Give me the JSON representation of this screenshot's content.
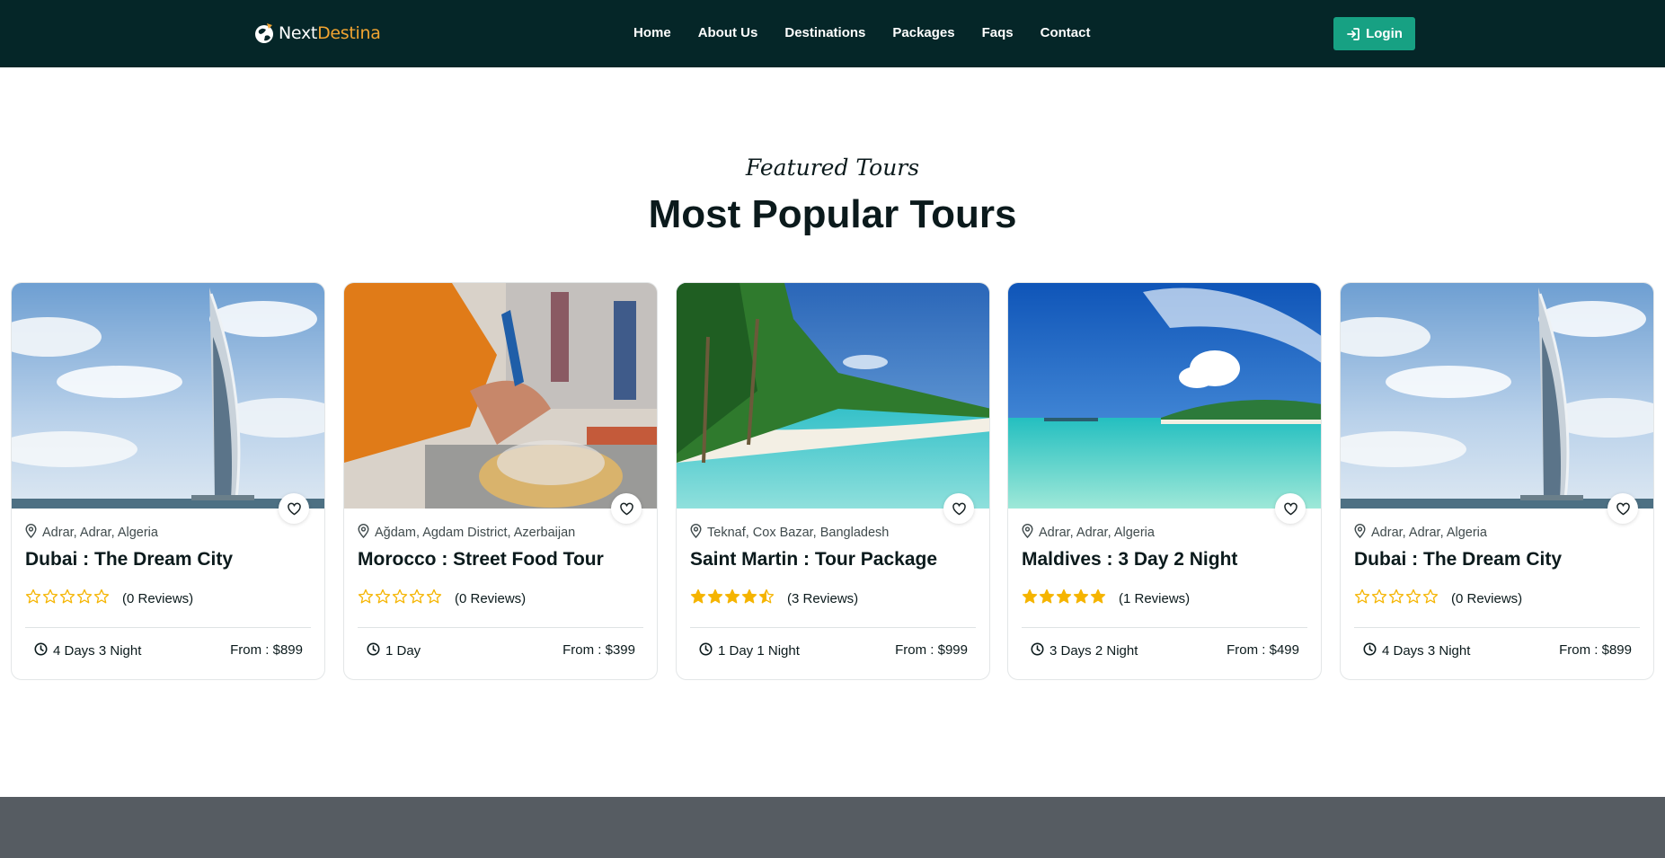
{
  "nav": {
    "logo": {
      "part1": "Next",
      "part2": "Destina"
    },
    "links": [
      "Home",
      "About Us",
      "Destinations",
      "Packages",
      "Faqs",
      "Contact"
    ],
    "login_label": "Login"
  },
  "section": {
    "eyebrow": "Featured Tours",
    "title": "Most Popular Tours"
  },
  "tours": [
    {
      "location": "Adrar, Adrar, Algeria",
      "title": "Dubai : The Dream City",
      "rating": 0,
      "reviews": "(0 Reviews)",
      "duration": "4 Days 3 Night",
      "price": "From : $899",
      "image": "dubai"
    },
    {
      "location": "Ağdam, Agdam District, Azerbaijan",
      "title": "Morocco : Street Food Tour",
      "rating": 0,
      "reviews": "(0 Reviews)",
      "duration": "1 Day",
      "price": "From : $399",
      "image": "street-food"
    },
    {
      "location": "Teknaf, Cox Bazar, Bangladesh",
      "title": "Saint Martin : Tour Package",
      "rating": 4.5,
      "reviews": "(3 Reviews)",
      "duration": "1 Day 1 Night",
      "price": "From : $999",
      "image": "beach-palms"
    },
    {
      "location": "Adrar, Adrar, Algeria",
      "title": "Maldives : 3 Day 2 Night",
      "rating": 5,
      "reviews": "(1 Reviews)",
      "duration": "3 Days 2 Night",
      "price": "From : $499",
      "image": "lagoon"
    },
    {
      "location": "Adrar, Adrar, Algeria",
      "title": "Dubai : The Dream City",
      "rating": 0,
      "reviews": "(0 Reviews)",
      "duration": "4 Days 3 Night",
      "price": "From : $899",
      "image": "dubai"
    }
  ],
  "colors": {
    "nav_bg": "#052628",
    "accent": "#17a183",
    "logo_orange": "#f2a431",
    "star": "#f5b400",
    "footer_band": "#565c62"
  }
}
